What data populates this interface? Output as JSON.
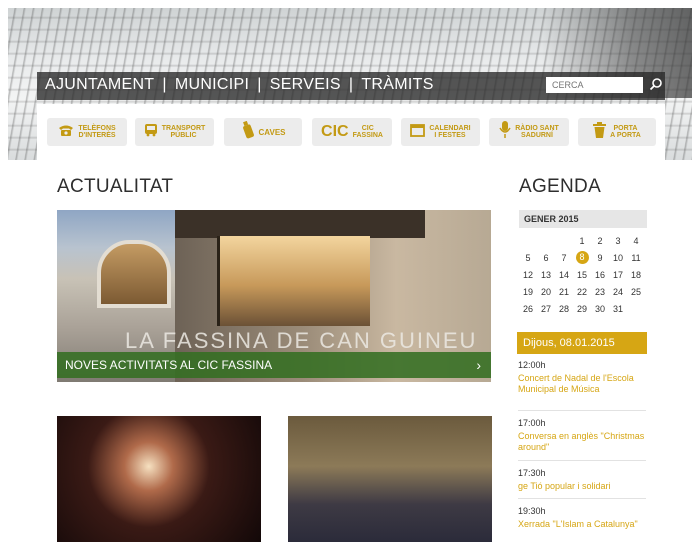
{
  "nav": {
    "items": [
      "AJUNTAMENT",
      "MUNICIPI",
      "SERVEIS",
      "TRÀMITS"
    ],
    "separator": "|",
    "search_placeholder": "CERCA"
  },
  "quicklinks": [
    {
      "icon": "phone-icon",
      "lines": [
        "TELÈFONS",
        "D'INTERÈS"
      ]
    },
    {
      "icon": "bus-icon",
      "lines": [
        "TRANSPORT",
        "PÚBLIC"
      ]
    },
    {
      "icon": "bottle-icon",
      "lines": [
        "CAVES"
      ]
    },
    {
      "icon": "cic-logo",
      "logo": "CIC",
      "lines": [
        "CIC",
        "FASSINA"
      ]
    },
    {
      "icon": "calendar-icon",
      "lines": [
        "CALENDARI",
        "I FESTES"
      ]
    },
    {
      "icon": "microphone-icon",
      "lines": [
        "RÀDIO SANT",
        "SADURNÍ"
      ]
    },
    {
      "icon": "trash-bin-icon",
      "lines": [
        "PORTA",
        "A PORTA"
      ]
    }
  ],
  "actualitat": {
    "title": "ACTUALITAT",
    "main_image_text": "LA FASSINA DE CAN GUINEU",
    "caption": "NOVES ACTIVITATS AL CIC FASSINA"
  },
  "agenda": {
    "title": "AGENDA",
    "month": "GENER 2015",
    "weeks": [
      [
        "",
        "",
        "",
        "1",
        "2",
        "3",
        "4"
      ],
      [
        "5",
        "6",
        "7",
        "8",
        "9",
        "10",
        "11"
      ],
      [
        "12",
        "13",
        "14",
        "15",
        "16",
        "17",
        "18"
      ],
      [
        "19",
        "20",
        "21",
        "22",
        "23",
        "24",
        "25"
      ],
      [
        "26",
        "27",
        "28",
        "29",
        "30",
        "31",
        ""
      ]
    ],
    "today": "8",
    "date_label": "Dijous, 08.01.2015",
    "events": [
      {
        "time": "12:00h",
        "title": "Concert de Nadal de l'Escola Municipal de Música"
      },
      {
        "time": "17:00h",
        "title": "Conversa en anglès \"Christmas around\""
      },
      {
        "time": "17:30h",
        "title": "ge Tió popular i solidari"
      },
      {
        "time": "19:30h",
        "title": "Xerrada \"L'Islam a Catalunya\""
      }
    ]
  },
  "colors": {
    "accent": "#d6a614",
    "caption_green": "#346e22",
    "nav_bg": "#282828"
  }
}
